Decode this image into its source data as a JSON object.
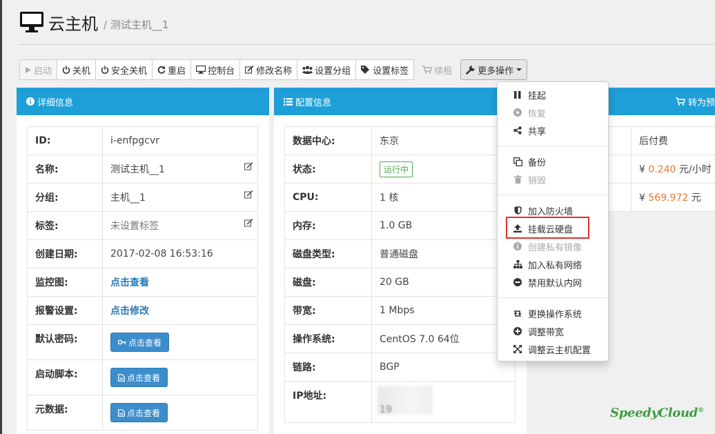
{
  "header": {
    "title": "云主机",
    "breadcrumb": "/ 测试主机__1"
  },
  "toolbar": {
    "start": "启动",
    "shutdown": "关机",
    "safe_shutdown": "安全关机",
    "restart": "重启",
    "console": "控制台",
    "rename": "修改名称",
    "set_group": "设置分组",
    "set_tag": "设置标签",
    "renew": "续租",
    "more": "更多操作"
  },
  "detail": {
    "title": "详细信息",
    "rows": [
      {
        "k": "ID:",
        "v": "i-enfpgcvr"
      },
      {
        "k": "名称:",
        "v": "测试主机__1"
      },
      {
        "k": "分组:",
        "v": "主机__1"
      },
      {
        "k": "标签:",
        "v": "未设置标签"
      },
      {
        "k": "创建日期:",
        "v": "2017-02-08 16:53:16"
      },
      {
        "k": "监控图:",
        "v": "点击查看"
      },
      {
        "k": "报警设置:",
        "v": "点击修改"
      },
      {
        "k": "默认密码:",
        "v": "点击查看"
      },
      {
        "k": "启动脚本:",
        "v": "点击查看"
      },
      {
        "k": "元数据:",
        "v": "点击查看"
      }
    ]
  },
  "config": {
    "title": "配置信息",
    "rows": [
      {
        "k": "数据中心:",
        "v": "东京"
      },
      {
        "k": "状态:",
        "v": "运行中"
      },
      {
        "k": "CPU:",
        "v": "1 核"
      },
      {
        "k": "内存:",
        "v": "1.0 GB"
      },
      {
        "k": "磁盘类型:",
        "v": "普通磁盘"
      },
      {
        "k": "磁盘:",
        "v": "20 GB"
      },
      {
        "k": "带宽:",
        "v": "1 Mbps"
      },
      {
        "k": "操作系统:",
        "v": "CentOS 7.0 64位"
      },
      {
        "k": "链路:",
        "v": "BGP"
      },
      {
        "k": "IP地址:",
        "v": ""
      }
    ],
    "ip_partial": "19"
  },
  "billing": {
    "title": "转为预",
    "type": "后付费",
    "hourly_symbol": "¥",
    "hourly_value": "0.240",
    "hourly_unit": "元/小时",
    "monthly_symbol": "¥",
    "monthly_value": "569.972",
    "monthly_unit": "元"
  },
  "menu": {
    "suspend": "挂起",
    "resume": "恢复",
    "share": "共享",
    "backup": "备份",
    "destroy": "销毁",
    "firewall": "加入防火墙",
    "attach_disk": "挂载云硬盘",
    "create_image": "创建私有镜像",
    "private_net": "加入私有网络",
    "disable_intranet": "禁用默认内网",
    "change_os": "更换操作系统",
    "adjust_bandwidth": "调整带宽",
    "resize": "调整云主机配置"
  },
  "logo": {
    "text": "SpeedyCloud",
    "mark": "®"
  },
  "colors": {
    "panel_header": "#1e9fd8",
    "price": "#e8772e",
    "status_green": "#4cae4c",
    "highlight": "#d9302c",
    "link": "#2a7ab8"
  }
}
